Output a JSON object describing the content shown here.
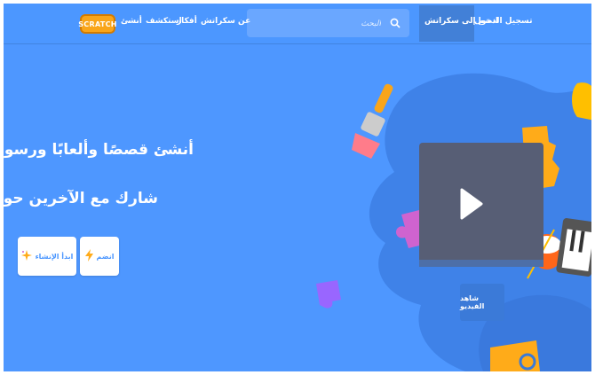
{
  "nav": {
    "login": "تسجيل الدخول",
    "join": "انضم إلى سكراتش",
    "search_placeholder": "البحث",
    "about": "عن سكراتش",
    "ideas": "أفكار",
    "explore": "استكشف",
    "create": "أنشئ",
    "logo": "SCRATCH"
  },
  "hero": {
    "headline": "أنشئ قصصًا وألعابًا ورسومًا متحركة",
    "subhead": "شارك مع الآخرين حول العالم",
    "start_button": "ابدأ الإنشاء",
    "join_button": "انضم",
    "watch_video": "شاهد الفيديو"
  },
  "colors": {
    "background": "#4e97ff",
    "blob": "#3e80e6",
    "button_text": "#4c97ff",
    "accent": "#ffbf00"
  },
  "icons": [
    "search-icon",
    "sparkle-icon",
    "lightning-icon",
    "play-icon",
    "paintbrush-icon",
    "puzzle-icon",
    "drum-icon",
    "keyboard-icon"
  ]
}
